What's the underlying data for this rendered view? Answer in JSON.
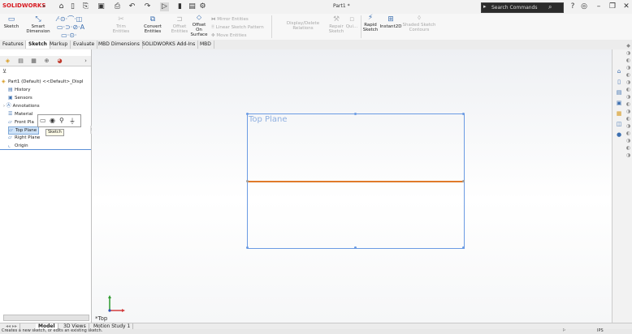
{
  "app": {
    "logo": "SOLIDWORKS",
    "document_title": "Part1 *"
  },
  "search": {
    "placeholder": "Search Commands"
  },
  "command_manager": {
    "sketch": "Sketch",
    "smart_dimension": "Smart Dimension",
    "trim_entities": "Trim Entities",
    "convert_entities": "Convert Entities",
    "offset_entities_1": "Offset",
    "offset_entities_2": "Entities",
    "offset_on_surface_1": "Offset On",
    "offset_on_surface_2": "Surface",
    "mirror_entities": "Mirror Entities",
    "linear_sketch_pattern": "Linear Sketch Pattern",
    "move_entities": "Move Entities",
    "display_delete_relations": "Display/Delete Relations",
    "repair_sketch_1": "Repair",
    "repair_sketch_2": "Sketch",
    "quick_snaps": "Qui...",
    "rapid_sketch_1": "Rapid",
    "rapid_sketch_2": "Sketch",
    "instant2d": "Instant2D",
    "shaded_sketch_1": "Shaded Sketch",
    "shaded_sketch_2": "Contours"
  },
  "tabs": [
    "Features",
    "Sketch",
    "Markup",
    "Evaluate",
    "MBD Dimensions",
    "SOLIDWORKS Add-Ins",
    "MBD"
  ],
  "tree": {
    "root": "Part1 (Default) <<Default>_Displ",
    "items": [
      "History",
      "Sensors",
      "Annotations",
      "Material",
      "Front Pla",
      "Top Plane",
      "Right Plane",
      "Origin"
    ]
  },
  "tooltip": "Sketch",
  "graphics": {
    "plane_label": "Top Plane",
    "view_label": "*Top"
  },
  "bottom_tabs": [
    "Model",
    "3D Views",
    "Motion Study 1"
  ],
  "status": {
    "message": "Creates a new sketch, or edits an existing sketch.",
    "units": "IPS"
  },
  "colors": {
    "plane_border": "#6b9be3",
    "selected_edge": "#e07a2a",
    "logo_red": "#d71920"
  }
}
